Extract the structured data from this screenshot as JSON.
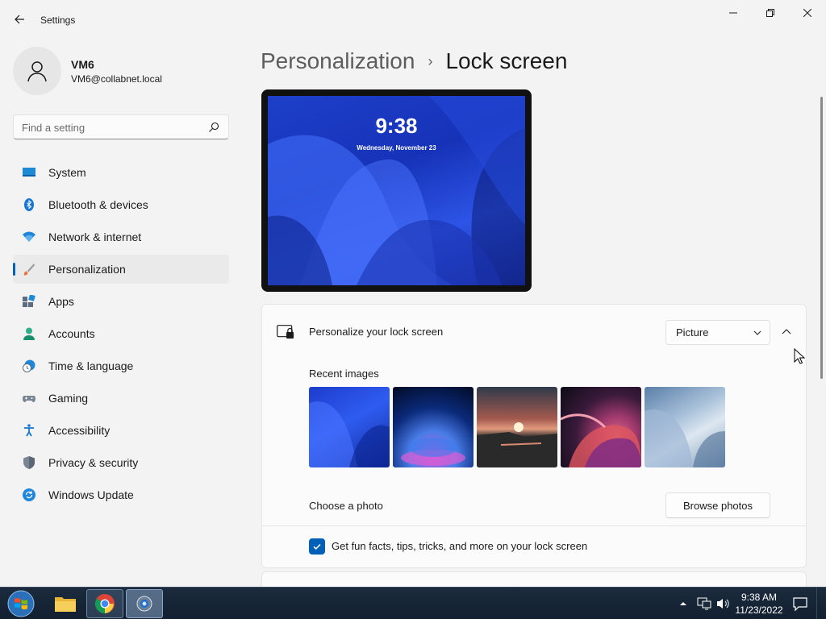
{
  "window": {
    "title": "Settings"
  },
  "user": {
    "name": "VM6",
    "email": "VM6@collabnet.local"
  },
  "search": {
    "placeholder": "Find a setting"
  },
  "nav": {
    "items": [
      {
        "label": "System",
        "icon": "monitor-icon"
      },
      {
        "label": "Bluetooth & devices",
        "icon": "bluetooth-icon"
      },
      {
        "label": "Network & internet",
        "icon": "wifi-icon"
      },
      {
        "label": "Personalization",
        "icon": "brush-icon",
        "active": true
      },
      {
        "label": "Apps",
        "icon": "apps-icon"
      },
      {
        "label": "Accounts",
        "icon": "person-icon"
      },
      {
        "label": "Time & language",
        "icon": "clock-globe-icon"
      },
      {
        "label": "Gaming",
        "icon": "gamepad-icon"
      },
      {
        "label": "Accessibility",
        "icon": "accessibility-icon"
      },
      {
        "label": "Privacy & security",
        "icon": "shield-icon"
      },
      {
        "label": "Windows Update",
        "icon": "update-icon"
      }
    ]
  },
  "header": {
    "parent": "Personalization",
    "separator": "›",
    "current": "Lock screen"
  },
  "preview": {
    "time": "9:38",
    "date": "Wednesday, November 23"
  },
  "lock_screen": {
    "label": "Personalize your lock screen",
    "dropdown_value": "Picture",
    "recent_images_label": "Recent images",
    "recent_images": [
      "wallpaper-bloom-blue",
      "wallpaper-glow-orb",
      "wallpaper-sunset-lake",
      "wallpaper-ribbon-swirl",
      "wallpaper-bloom-light"
    ],
    "choose_photo_label": "Choose a photo",
    "browse_button": "Browse photos",
    "tips_label": "Get fun facts, tips, tricks, and more on your lock screen",
    "tips_checked": true
  },
  "taskbar": {
    "time": "9:38 AM",
    "date": "11/23/2022"
  },
  "colors": {
    "accent": "#005fb8",
    "background": "#f3f3f3",
    "card": "#fbfbfb",
    "taskbar": "#1b2b3d"
  }
}
